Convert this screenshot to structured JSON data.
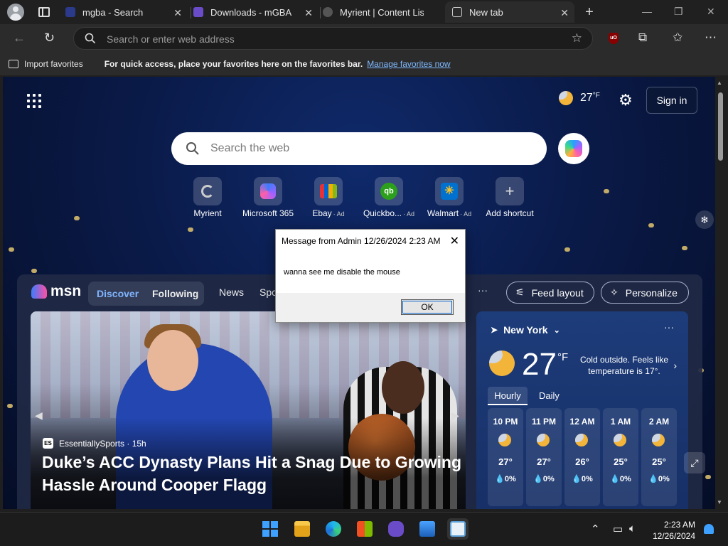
{
  "browser": {
    "tabs": [
      {
        "title": "mgba - Search",
        "favicon_color": "#2b3a8a",
        "active": false
      },
      {
        "title": "Downloads - mGBA",
        "favicon_color": "#6a4cc9",
        "active": false
      },
      {
        "title": "Myrient | Content Listi",
        "favicon_color": "#555555",
        "active": false
      },
      {
        "title": "New tab",
        "favicon_color": "#cccccc",
        "active": true
      }
    ],
    "address_placeholder": "Search or enter web address"
  },
  "favorites_bar": {
    "import_label": "Import favorites",
    "hint": "For quick access, place your favorites here on the favorites bar.",
    "manage_link": "Manage favorites now"
  },
  "ntp": {
    "weather_temp": "27",
    "weather_unit": "°F",
    "sign_in": "Sign in",
    "search_placeholder": "Search the web",
    "shortcuts": [
      {
        "label": "Myrient",
        "ad": "",
        "icon": "myrient-icon",
        "color": "#333333"
      },
      {
        "label": "Microsoft 365",
        "ad": "",
        "icon": "m365-icon",
        "color": "#6b4bd8"
      },
      {
        "label": "Ebay",
        "ad": "· Ad",
        "icon": "ebay-icon",
        "color": "#e53238"
      },
      {
        "label": "Quickbo...",
        "ad": "· Ad",
        "icon": "quickbooks-icon",
        "color": "#2ca01c"
      },
      {
        "label": "Walmart",
        "ad": "· Ad",
        "icon": "walmart-icon",
        "color": "#0071ce"
      },
      {
        "label": "Add shortcut",
        "ad": "",
        "icon": "plus-icon",
        "color": "#5a6078"
      }
    ]
  },
  "msn": {
    "logo": "msn",
    "tabs": {
      "discover": "Discover",
      "following": "Following",
      "news": "News",
      "sports": "Spo"
    },
    "feed_layout": "Feed layout",
    "personalize": "Personalize",
    "hero": {
      "source": "EssentiallySports · 15h",
      "source_badge": "ES",
      "headline": "Duke’s ACC Dynasty Plans Hit a Snag Due to Growing Hassle Around Cooper Flagg"
    },
    "weather": {
      "location": "New York",
      "temp": "27",
      "unit": "°F",
      "note": "Cold outside. Feels like temperature is 17°.",
      "tab_hourly": "Hourly",
      "tab_daily": "Daily",
      "hours": [
        {
          "time": "10 PM",
          "temp": "27°",
          "precip": "💧0%"
        },
        {
          "time": "11 PM",
          "temp": "27°",
          "precip": "💧0%"
        },
        {
          "time": "12 AM",
          "temp": "26°",
          "precip": "💧0%"
        },
        {
          "time": "1 AM",
          "temp": "25°",
          "precip": "💧0%"
        },
        {
          "time": "2 AM",
          "temp": "25°",
          "precip": "💧0%"
        }
      ]
    }
  },
  "dialog": {
    "title": "Message from Admin 12/26/2024 2:23 AM",
    "message": "wanna see me disable the mouse",
    "ok": "OK"
  },
  "taskbar": {
    "time": "2:23 AM",
    "date": "12/26/2024"
  }
}
